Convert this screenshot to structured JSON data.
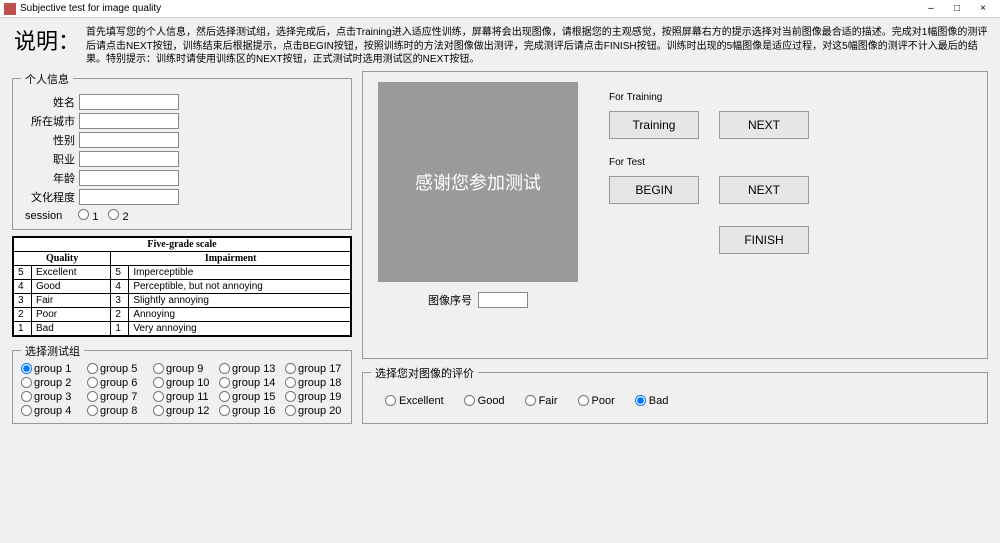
{
  "window": {
    "title": "Subjective test for image quality",
    "minimize": "–",
    "maximize": "□",
    "close": "×"
  },
  "instructions": {
    "label": "说明：",
    "text": "首先填写您的个人信息，然后选择测试组，选择完成后，点击Training进入适应性训练，屏幕将会出现图像，请根据您的主观感觉，按照屏幕右方的提示选择对当前图像最合适的描述。完成对1幅图像的测评后请点击NEXT按钮，训练结束后根据提示，点击BEGIN按钮，按照训练时的方法对图像做出测评，完成测评后请点击FINISH按钮。训练时出现的5幅图像是适应过程，对这5幅图像的测评不计入最后的结果。特别提示：训练时请使用训练区的NEXT按钮，正式测试时选用测试区的NEXT按钮。"
  },
  "personal": {
    "legend": "个人信息",
    "fields": {
      "name": {
        "label": "姓名",
        "value": ""
      },
      "city": {
        "label": "所在城市",
        "value": ""
      },
      "gender": {
        "label": "性别",
        "value": ""
      },
      "occupation": {
        "label": "职业",
        "value": ""
      },
      "age": {
        "label": "年龄",
        "value": ""
      },
      "education": {
        "label": "文化程度",
        "value": ""
      }
    },
    "session": {
      "label": "session",
      "opt1": "1",
      "opt2": "2"
    }
  },
  "scale": {
    "title": "Five-grade scale",
    "quality_header": "Quality",
    "impair_header": "Impairment",
    "rows": [
      {
        "n": "5",
        "q": "Excellent",
        "i": "Imperceptible"
      },
      {
        "n": "4",
        "q": "Good",
        "i": "Perceptible, but not annoying"
      },
      {
        "n": "3",
        "q": "Fair",
        "i": "Slightly annoying"
      },
      {
        "n": "2",
        "q": "Poor",
        "i": "Annoying"
      },
      {
        "n": "1",
        "q": "Bad",
        "i": "Very annoying"
      }
    ]
  },
  "groups": {
    "legend": "选择测试组",
    "items": [
      "group 1",
      "group 2",
      "group 3",
      "group 4",
      "group 5",
      "group 6",
      "group 7",
      "group 8",
      "group 9",
      "group 10",
      "group 11",
      "group 12",
      "group 13",
      "group 14",
      "group 15",
      "group 16",
      "group 17",
      "group 18",
      "group 19",
      "group 20"
    ],
    "selected": 0
  },
  "main": {
    "image_text": "感谢您参加测试",
    "seq_label": "图像序号",
    "seq_value": "",
    "training_label": "For Training",
    "test_label": "For Test",
    "btn_training": "Training",
    "btn_next": "NEXT",
    "btn_begin": "BEGIN",
    "btn_finish": "FINISH"
  },
  "rating": {
    "legend": "选择您对图像的评价",
    "options": [
      "Excellent",
      "Good",
      "Fair",
      "Poor",
      "Bad"
    ],
    "selected": 4
  }
}
